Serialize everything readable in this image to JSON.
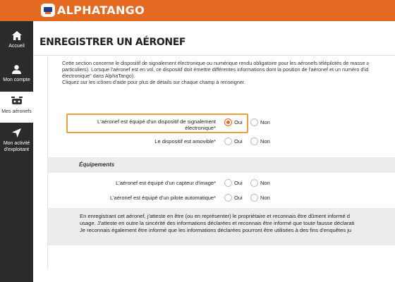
{
  "header": {
    "app_name": "ALPHATANGO",
    "logo_icon": "drone-controller-icon",
    "accent_color": "#e46a22"
  },
  "sidebar": {
    "items": [
      {
        "label": "Accueil",
        "icon": "home-icon"
      },
      {
        "label": "Mon compte",
        "icon": "user-icon"
      },
      {
        "label": "Mes aéronefs",
        "icon": "drone-icon",
        "active": true
      },
      {
        "label": "Mon activité d'exploitant",
        "icon": "navigation-arrow-icon"
      }
    ]
  },
  "page": {
    "title": "ENREGISTRER UN AÉRONEF"
  },
  "intro": {
    "lines": [
      "Cette section concerne le dispositif de signalement électronique ou numérique rendu obligatoire pour les aéronefs télépilotés de masse ≥",
      "particuliers). Lorsque l'aéronef est en vol, ce dispositif doit émettre différentes informations dont la position de l'aéronef et un numéro d'id",
      "électronique\" dans AlphaTango).",
      "Cliquez sur les icônes d'aide pour plus de détails sur chaque champ à renseigner."
    ]
  },
  "form": {
    "questions": [
      {
        "label_line1": "L'aéronef est équipé d'un dispositif de signalement",
        "label_line2": "électronique*",
        "yes": "Oui",
        "no": "Non",
        "selected": "Oui"
      },
      {
        "label": "Le dispositif est amovible*",
        "yes": "Oui",
        "no": "Non",
        "selected": ""
      }
    ],
    "equipment_section": "Équipements",
    "equipment_questions": [
      {
        "label": "L'aéronef est équipé d'un capteur d'image*",
        "yes": "Oui",
        "no": "Non",
        "selected": ""
      },
      {
        "label": "L'aéronef est équipé d'un pilote automatique*",
        "yes": "Oui",
        "no": "Non",
        "selected": ""
      }
    ]
  },
  "attestation": {
    "lines": [
      "En enregistrant cet aéronef, j'atteste en être (ou en représenter) le propriétaire et reconnais être dûment informé d",
      "usage. J'atteste en outre la sincérité des informations déclarées et reconnais être informé que toute fausse déclarati",
      "Je reconnais également être informé que les informations déclarées pourront être utilisées à des fins d'enquêtes ju"
    ]
  }
}
